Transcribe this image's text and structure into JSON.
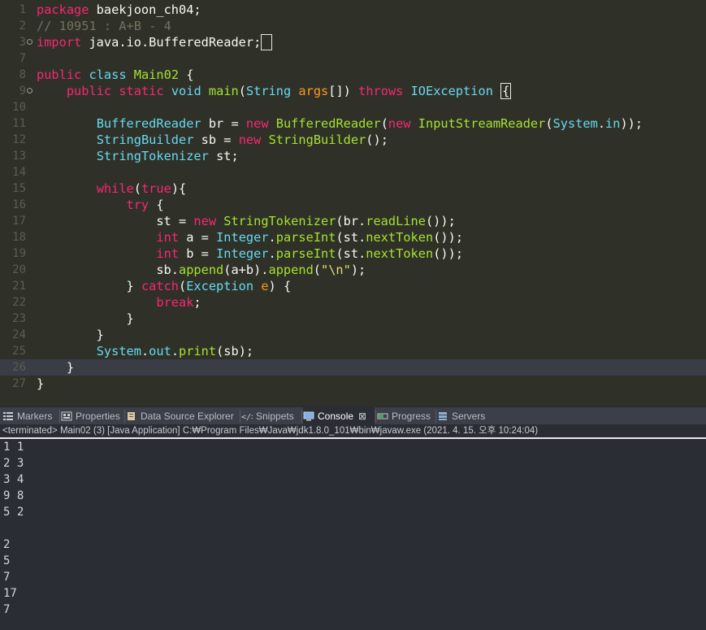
{
  "editor": {
    "current_line": 26,
    "lines": [
      {
        "n": "1",
        "fold": false,
        "html": "<span class='k'>package</span> baekjoon_ch04;"
      },
      {
        "n": "2",
        "fold": false,
        "html": "<span class='c'>// 10951 : A+B - 4</span>"
      },
      {
        "n": "3",
        "fold": true,
        "html": "<span class='k'>import</span> java.io.BufferedReader;<span class='box'> </span>"
      },
      {
        "n": "7",
        "fold": false,
        "html": ""
      },
      {
        "n": "8",
        "fold": false,
        "html": "<span class='k'>public</span> <span class='t'>class</span> <span class='f'>Main02</span> {"
      },
      {
        "n": "9",
        "fold": true,
        "html": "    <span class='k'>public</span> <span class='k'>static</span> <span class='t'>void</span> <span class='f'>main</span>(<span class='t'>String</span> <span class='p'>args</span>[]) <span class='k'>throws</span> <span class='t'>IOException</span> <span class='box'>{</span>"
      },
      {
        "n": "10",
        "fold": false,
        "html": ""
      },
      {
        "n": "11",
        "fold": false,
        "html": "        <span class='t'>BufferedReader</span> <span class='pl'>br</span> = <span class='k'>new</span> <span class='f'>BufferedReader</span>(<span class='k'>new</span> <span class='f'>InputStreamReader</span>(<span class='t'>System</span>.<span class='t'>in</span>));"
      },
      {
        "n": "12",
        "fold": false,
        "html": "        <span class='t'>StringBuilder</span> <span class='pl'>sb</span> = <span class='k'>new</span> <span class='f'>StringBuilder</span>();"
      },
      {
        "n": "13",
        "fold": false,
        "html": "        <span class='t'>StringTokenizer</span> <span class='pl'>st</span>;"
      },
      {
        "n": "14",
        "fold": false,
        "html": ""
      },
      {
        "n": "15",
        "fold": false,
        "html": "        <span class='k'>while</span>(<span class='k'>true</span>){"
      },
      {
        "n": "16",
        "fold": false,
        "html": "            <span class='k'>try</span> {"
      },
      {
        "n": "17",
        "fold": false,
        "html": "                st = <span class='k'>new</span> <span class='f'>StringTokenizer</span>(br.<span class='f'>readLine</span>());"
      },
      {
        "n": "18",
        "fold": false,
        "html": "                <span class='k'>int</span> <span class='pl'>a</span> = <span class='t'>Integer</span>.<span class='f'>parseInt</span>(st.<span class='f'>nextToken</span>());"
      },
      {
        "n": "19",
        "fold": false,
        "html": "                <span class='k'>int</span> <span class='pl'>b</span> = <span class='t'>Integer</span>.<span class='f'>parseInt</span>(st.<span class='f'>nextToken</span>());"
      },
      {
        "n": "20",
        "fold": false,
        "html": "                sb.<span class='f'>append</span>(a+b).<span class='f'>append</span>(<span class='s'>\"\\n\"</span>);"
      },
      {
        "n": "21",
        "fold": false,
        "html": "            } <span class='k'>catch</span>(<span class='t'>Exception</span> <span class='p'>e</span>) {"
      },
      {
        "n": "22",
        "fold": false,
        "html": "                <span class='k'>break</span>;"
      },
      {
        "n": "23",
        "fold": false,
        "html": "            }"
      },
      {
        "n": "24",
        "fold": false,
        "html": "        }"
      },
      {
        "n": "25",
        "fold": false,
        "html": "        <span class='t'>System</span>.<span class='t'>out</span>.<span class='f'>print</span>(sb);"
      },
      {
        "n": "26",
        "fold": false,
        "html": "    }"
      },
      {
        "n": "27",
        "fold": false,
        "html": "}"
      }
    ]
  },
  "views": {
    "tabs": [
      {
        "label": "Markers",
        "icon": "markers-icon",
        "active": false
      },
      {
        "label": "Properties",
        "icon": "properties-icon",
        "active": false
      },
      {
        "label": "Data Source Explorer",
        "icon": "data-source-icon",
        "active": false
      },
      {
        "label": "Snippets",
        "icon": "snippets-icon",
        "active": false
      },
      {
        "label": "Console",
        "icon": "console-icon",
        "active": true
      },
      {
        "label": "Progress",
        "icon": "progress-icon",
        "active": false
      },
      {
        "label": "Servers",
        "icon": "servers-icon",
        "active": false
      }
    ],
    "close_glyph": "⊠"
  },
  "console": {
    "status": "<terminated> Main02 (3) [Java Application] C:₩Program Files₩Java₩jdk1.8.0_101₩bin₩javaw.exe (2021. 4. 15. 오후 10:24:04)",
    "output": [
      "1 1",
      "2 3",
      "3 4",
      "9 8",
      "5 2",
      "",
      "2",
      "5",
      "7",
      "17",
      "7"
    ]
  }
}
